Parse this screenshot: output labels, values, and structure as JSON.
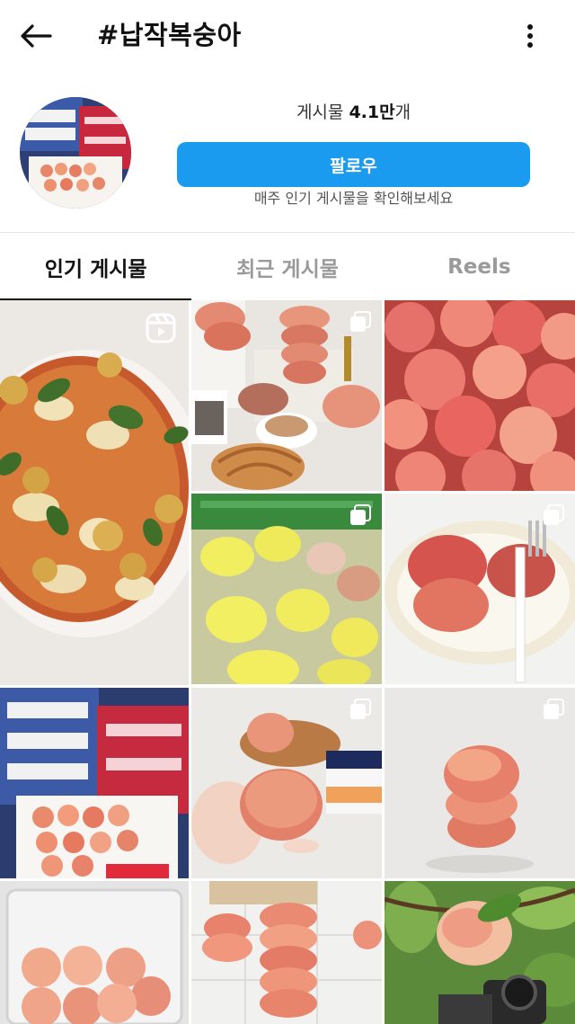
{
  "header": {
    "title": "#납작복숭아",
    "back_icon": "arrow-left-icon",
    "more_icon": "more-vertical-icon"
  },
  "hashtag_info": {
    "posts_label": "게시물",
    "posts_count": "4.1만",
    "posts_unit": "개",
    "follow_label": "팔로우",
    "subtitle": "매주 인기 게시물을 확인해보세요",
    "accent_color": "#1a9bf0"
  },
  "tabs": [
    {
      "label": "인기 게시물",
      "active": true
    },
    {
      "label": "최근 게시물",
      "active": false
    },
    {
      "label": "Reels",
      "active": false
    }
  ],
  "posts": [
    {
      "subject": "pizza with flat peaches",
      "badge": "reels-icon"
    },
    {
      "subject": "flat peaches, coffee and croissant",
      "badge": "multiple-photos-icon"
    },
    {
      "subject": "pile of flat peaches",
      "badge": "none"
    },
    {
      "subject": "flat peaches in yellow net sleeves",
      "badge": "multiple-photos-icon"
    },
    {
      "subject": "flat peaches on white plate with fork",
      "badge": "multiple-photos-icon"
    },
    {
      "subject": "boxes of flat peaches",
      "badge": "none"
    },
    {
      "subject": "hand holding flat peach with yogurt",
      "badge": "multiple-photos-icon"
    },
    {
      "subject": "stacked flat peaches",
      "badge": "multiple-photos-icon"
    },
    {
      "subject": "flat peaches in plastic container",
      "badge": "none"
    },
    {
      "subject": "stacks of flat peaches on tiles",
      "badge": "none"
    },
    {
      "subject": "flat peach on branch with camera",
      "badge": "none"
    }
  ]
}
